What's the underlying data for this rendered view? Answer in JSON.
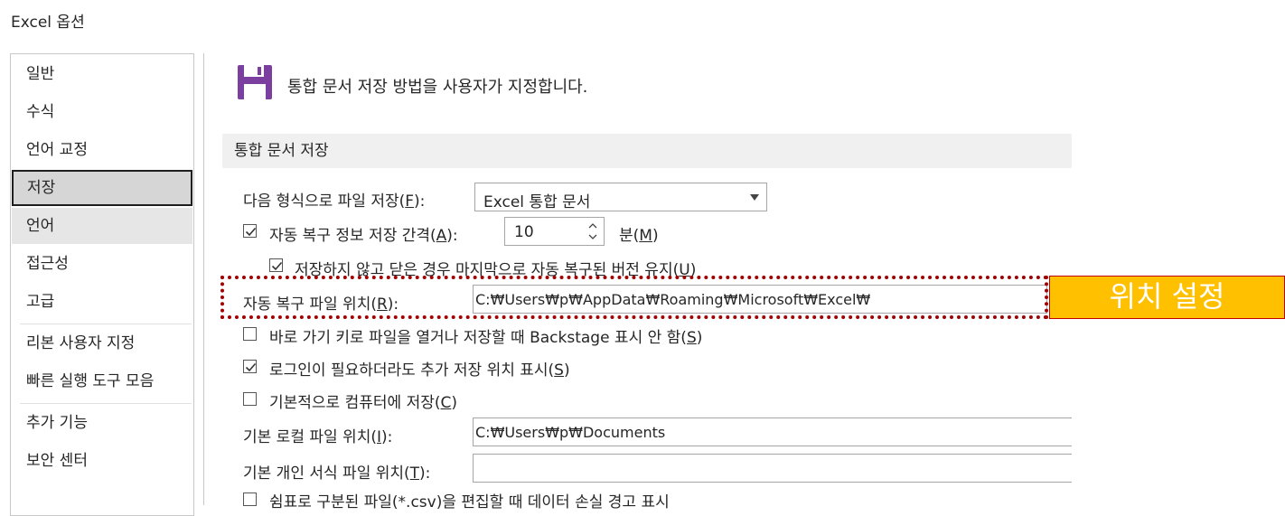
{
  "window": {
    "title": "Excel 옵션"
  },
  "sidebar": {
    "items": [
      {
        "label": "일반"
      },
      {
        "label": "수식"
      },
      {
        "label": "언어 교정"
      },
      {
        "label": "저장"
      },
      {
        "label": "언어"
      },
      {
        "label": "접근성"
      },
      {
        "label": "고급"
      },
      {
        "label": "리본 사용자 지정"
      },
      {
        "label": "빠른 실행 도구 모음"
      },
      {
        "label": "추가 기능"
      },
      {
        "label": "보안 센터"
      }
    ],
    "selected": "저장"
  },
  "header": {
    "text": "통합 문서 저장 방법을 사용자가 지정합니다.",
    "icon": "save-disk-icon",
    "icon_color": "#7b3fa0"
  },
  "section": {
    "title": "통합 문서 저장"
  },
  "settings": {
    "save_format": {
      "label": "다음 형식으로 파일 저장(",
      "key": "F",
      "suffix": "):",
      "value": "Excel 통합 문서"
    },
    "autorecover": {
      "checked": true,
      "label": "자동 복구 정보 저장 간격(",
      "key": "A",
      "suffix": "):",
      "value": "10",
      "unit_label": "분(",
      "unit_key": "M",
      "unit_suffix": ")"
    },
    "keep_last": {
      "checked": true,
      "label": "저장하지 않고 닫은 경우 마지막으로 자동 복구된 버전 유지(",
      "key": "U",
      "suffix": ")"
    },
    "autorecover_location": {
      "label": "자동 복구 파일 위치(",
      "key": "R",
      "suffix": "):",
      "value": "C:₩Users₩p₩AppData₩Roaming₩Microsoft₩Excel₩"
    },
    "backstage": {
      "checked": false,
      "label": "바로 가기 키로 파일을 열거나 저장할 때 Backstage 표시 안 함(",
      "key": "S",
      "suffix": ")"
    },
    "extra_locations": {
      "checked": true,
      "label": "로그인이 필요하더라도 추가 저장 위치 표시(",
      "key": "S",
      "suffix": ")"
    },
    "save_to_computer": {
      "checked": false,
      "label": "기본적으로 컴퓨터에 저장(",
      "key": "C",
      "suffix": ")"
    },
    "default_local": {
      "label": "기본 로컬 파일 위치(",
      "key": "I",
      "suffix": "):",
      "value": "C:₩Users₩p₩Documents"
    },
    "personal_templates": {
      "label": "기본 개인 서식 파일 위치(",
      "key": "T",
      "suffix": "):",
      "value": ""
    },
    "csv_warning": {
      "checked": false,
      "label": "쉼표로 구분된 파일(*.csv)을 편집할 때 데이터 손실 경고 표시"
    }
  },
  "callout": {
    "text": "위치 설정",
    "bg": "#ffc000",
    "border": "#c00000"
  }
}
